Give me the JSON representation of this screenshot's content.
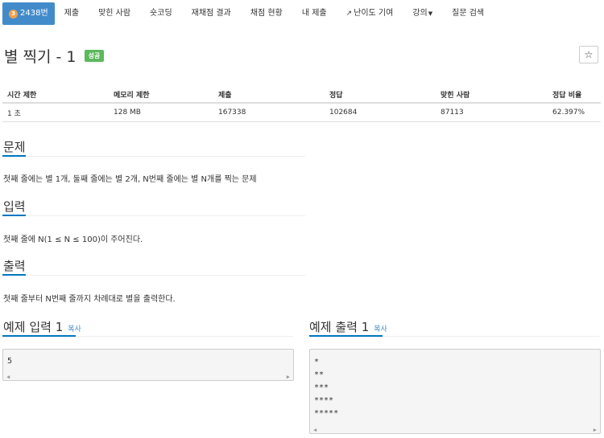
{
  "nav": {
    "tier_number": "3",
    "problem_id": "2438번",
    "tabs": [
      "제출",
      "맞힌 사람",
      "숏코딩",
      "재채점 결과",
      "채점 현황",
      "내 제출",
      "난이도 기여",
      "강의",
      "질문 검색"
    ]
  },
  "problem": {
    "title": "별 찍기 - 1",
    "status": "성공",
    "star_icon": "☆"
  },
  "info_table": {
    "headers": [
      "시간 제한",
      "메모리 제한",
      "제출",
      "정답",
      "맞힌 사람",
      "정답 비율"
    ],
    "values": [
      "1 초",
      "128 MB",
      "167338",
      "102684",
      "87113",
      "62.397%"
    ]
  },
  "sections": {
    "description_title": "문제",
    "description_text": "첫째 줄에는 별 1개, 둘째 줄에는 별 2개, N번째 줄에는 별 N개를 찍는 문제",
    "input_title": "입력",
    "input_text": "첫째 줄에 N(1 ≤ N ≤ 100)이 주어진다.",
    "output_title": "출력",
    "output_text": "첫째 줄부터 N번째 줄까지 차례대로 별을 출력한다."
  },
  "examples": {
    "input_title": "예제 입력 1",
    "output_title": "예제 출력 1",
    "copy_label": "복사",
    "input_lines": [
      "5"
    ],
    "output_lines": [
      "*",
      "**",
      "***",
      "****",
      "*****"
    ]
  },
  "colors": {
    "nav_active": "#428bca",
    "tier_badge": "#f0a04b",
    "success": "#5cb85c",
    "accent": "#0076c0"
  }
}
